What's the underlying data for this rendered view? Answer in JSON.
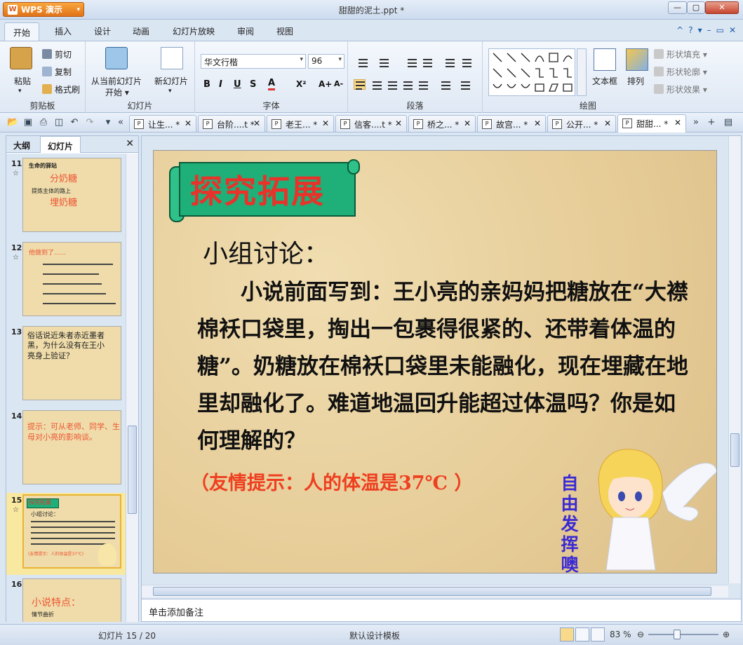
{
  "app": {
    "name": "WPS 演示",
    "document_title": "甜甜的泥土.ppt *"
  },
  "menu": {
    "tabs": [
      "开始",
      "插入",
      "设计",
      "动画",
      "幻灯片放映",
      "审阅",
      "视图"
    ],
    "active": "开始"
  },
  "ribbon": {
    "clipboard": {
      "paste": "粘贴",
      "cut": "剪切",
      "copy": "复制",
      "format_painter": "格式刷",
      "label": "剪贴板"
    },
    "slides": {
      "play_from_current": "从当前幻灯片",
      "start": "开始",
      "new_slide": "新幻灯片",
      "label": "幻灯片"
    },
    "font": {
      "font_name": "华文行楷",
      "font_size": "96",
      "bold": "B",
      "italic": "I",
      "underline": "U",
      "shadow": "S",
      "color": "A",
      "superscript": "X²",
      "grow": "A+",
      "shrink": "A-",
      "label": "字体"
    },
    "paragraph": {
      "label": "段落"
    },
    "drawing": {
      "text_box": "文本框",
      "arrange": "排列",
      "shape_fill": "形状填充",
      "shape_outline": "形状轮廓",
      "shape_effects": "形状效果",
      "label": "绘图"
    }
  },
  "doc_tabs": [
    {
      "label": "让生...",
      "mod": "*"
    },
    {
      "label": "台阶....t",
      "mod": "*"
    },
    {
      "label": "老王...",
      "mod": "*"
    },
    {
      "label": "信客....t",
      "mod": "*"
    },
    {
      "label": "桥之...",
      "mod": "*"
    },
    {
      "label": "故宫...",
      "mod": "*"
    },
    {
      "label": "公开...",
      "mod": "*"
    },
    {
      "label": "甜甜...",
      "mod": "*"
    }
  ],
  "left_panel": {
    "tabs": [
      "大纲",
      "幻灯片"
    ],
    "thumbs": [
      {
        "num": "11",
        "lines": [
          "生命的驿站",
          "分奶糖",
          "提炼主体的路上",
          "埋奶糖"
        ]
      },
      {
        "num": "12",
        "lines": [
          "他做到了......"
        ]
      },
      {
        "num": "13",
        "lines": [
          "俗话说近朱者赤近墨者黑，为什么没有在王小亮身上验证？"
        ]
      },
      {
        "num": "14",
        "lines": [
          "提示：可从老师、同学、生母对小亮的影响谈。"
        ]
      },
      {
        "num": "15",
        "lines": [
          "探究拓展",
          "小组讨论：",
          "(友情提示：人的体温是37℃)"
        ]
      },
      {
        "num": "16",
        "lines": [
          "小说特点：",
          "情节曲折"
        ]
      }
    ]
  },
  "slide": {
    "banner_title": "探究拓展",
    "subheading": "小组讨论：",
    "body": "小说前面写到：王小亮的亲妈妈把糖放在“大襟棉袄口袋里，掏出一包裹得很紧的、还带着体温的糖”。奶糖放在棉袄口袋里未能融化，现在埋藏在地里却融化了。难道地温回升能超过体温吗？你是如何理解的？",
    "hint": "（友情提示：人的体温是37℃ ）",
    "angel_text": "自由发挥噢"
  },
  "notes_placeholder": "单击添加备注",
  "status": {
    "slide_counter": "幻灯片 15 / 20",
    "template": "默认设计模板",
    "zoom": "83 %"
  },
  "colors": {
    "accent": "#1faf78",
    "title_red": "#e8322a",
    "hint_red": "#ee3f20",
    "angel_blue": "#3a2ad4",
    "chrome": "#dbe6f3"
  }
}
